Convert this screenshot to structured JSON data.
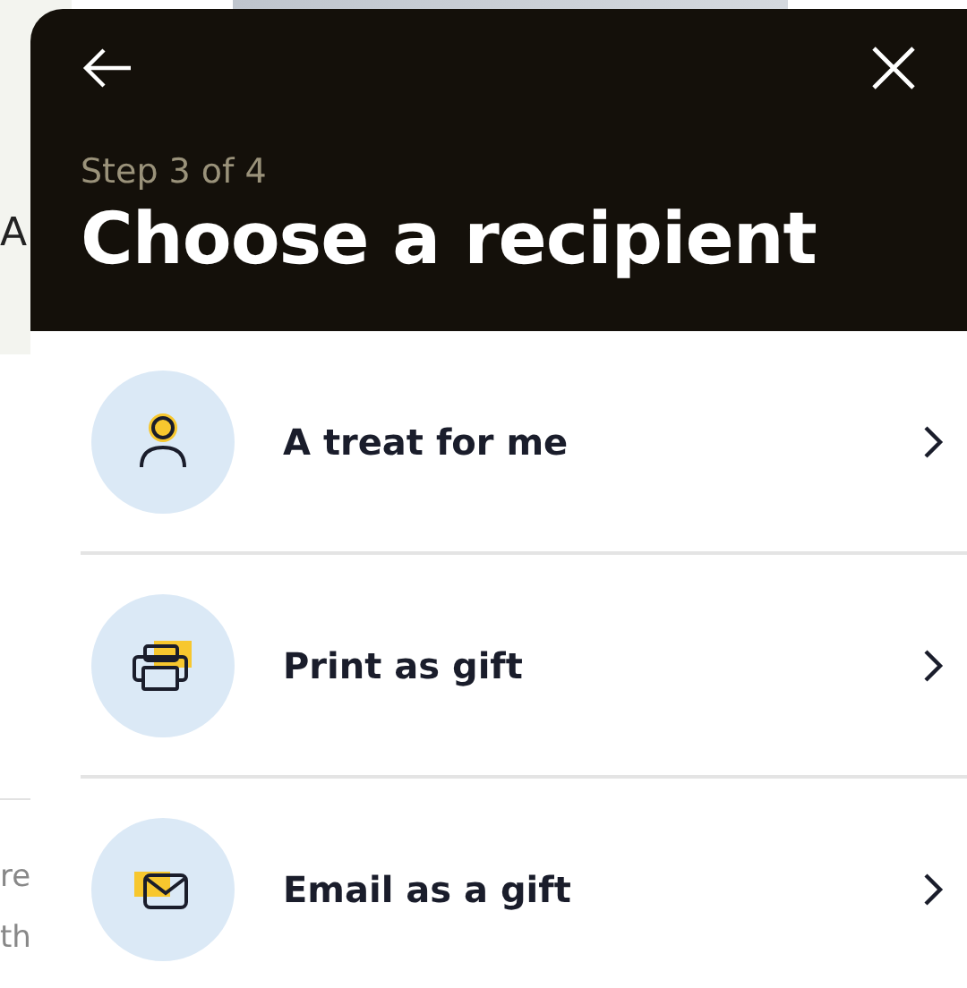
{
  "background": {
    "letter": "A",
    "text_lines": [
      "re",
      "th"
    ]
  },
  "sheet": {
    "step": "Step 3 of 4",
    "title": "Choose a recipient",
    "options": [
      {
        "kind": "self",
        "label": "A treat for me"
      },
      {
        "kind": "print",
        "label": "Print as gift"
      },
      {
        "kind": "email",
        "label": "Email as a gift"
      }
    ]
  }
}
